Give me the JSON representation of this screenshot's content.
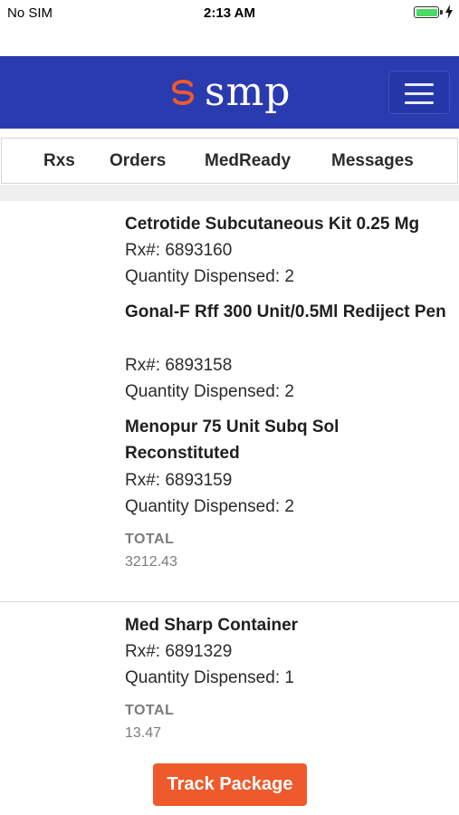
{
  "status_bar": {
    "carrier": "No SIM",
    "time": "2:13 AM",
    "battery_level": 1.0,
    "charging": true,
    "battery_color": "#4cd964"
  },
  "header": {
    "brand": "smp",
    "brand_color": "#2a3bb0",
    "logo_accent": "#ee5a2b",
    "menu_icon": "hamburger-icon"
  },
  "tabs": [
    {
      "label": "Rxs"
    },
    {
      "label": "Orders"
    },
    {
      "label": "MedReady"
    },
    {
      "label": "Messages"
    }
  ],
  "orders": [
    {
      "items": [
        {
          "name": "Cetrotide Subcutaneous Kit 0.25 Mg",
          "rx": "Rx#: 6893160",
          "quantity": "Quantity Dispensed: 2"
        },
        {
          "name": "Gonal-F Rff 300 Unit/0.5Ml Rediject Pen",
          "rx": "Rx#: 6893158",
          "quantity": "Quantity Dispensed: 2"
        },
        {
          "name": "Menopur 75 Unit Subq Sol Reconstituted",
          "rx": "Rx#: 6893159",
          "quantity": "Quantity Dispensed: 2"
        }
      ],
      "total_label": "TOTAL",
      "total_value": "3212.43"
    },
    {
      "items": [
        {
          "name": "Med Sharp Container",
          "rx": "Rx#: 6891329",
          "quantity": "Quantity Dispensed: 1"
        }
      ],
      "total_label": "TOTAL",
      "total_value": "13.47"
    }
  ],
  "track_button": {
    "label": "Track Package",
    "color": "#ee5a2b"
  }
}
